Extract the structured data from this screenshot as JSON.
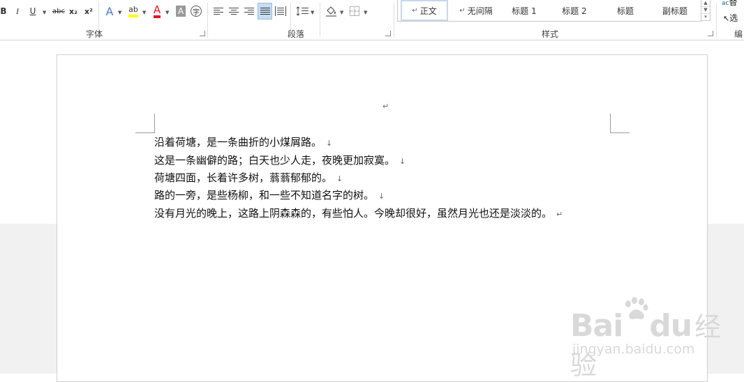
{
  "ribbon": {
    "font_buttons": [
      "B",
      "I",
      "U",
      "abc",
      "x₂",
      "x²",
      "A",
      "ab",
      "A",
      "A",
      "字"
    ],
    "groups": {
      "font": "字体",
      "paragraph": "段落",
      "styles": "样式",
      "editing": "编"
    },
    "styles": [
      "正文",
      "无间隔",
      "标题 1",
      "标题 2",
      "标题",
      "副标题"
    ],
    "editing_items": [
      "替",
      "选"
    ]
  },
  "document": {
    "lines": [
      "沿着荷塘，是一条曲折的小煤屑路。",
      "这是一条幽僻的路；白天也少人走，夜晚更加寂寞。",
      "荷塘四面，长着许多树，蓊蓊郁郁的。",
      "路的一旁，是些杨柳，和一些不知道名字的树。",
      "没有月光的晚上，这路上阴森森的，有些怕人。今晚却很好，虽然月光也还是淡淡的。"
    ],
    "line_break_mark": "↓",
    "paragraph_mark": "↵"
  },
  "watermark": {
    "brand": "Bai",
    "brand2": "du",
    "brand_cn": "经验",
    "url": "jingyan.baidu.com"
  },
  "colors": {
    "highlight": "#ffff00",
    "font_red": "#e81123",
    "selected_bg": "#c5dcf2"
  }
}
